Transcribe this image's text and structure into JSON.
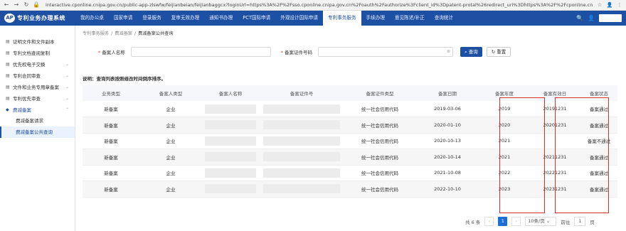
{
  "browser": {
    "url": "interactive.cponline.cnipa.gov.cn/public-app-zlswfw/feijianbeian/feijianbaggcx?loginUrl=https%3A%2F%2Fsso.cponline.cnipa.gov.cn%2Foauth%2Fauthorize%3Fclient_id%3Dpatent-protal%26redirect_uri%3Dhttps%3A%2F%2Fcponline.cnipa.gov.cn..."
  },
  "header": {
    "logo_mark": "AP",
    "title": "专利业务办理系统",
    "nav": [
      "我的办公桌",
      "国家申请",
      "登录服务",
      "复审无效办理",
      "通知书办理",
      "PCT国际申请",
      "外观设计国际申请",
      "专利事务服务",
      "手续办理",
      "意见陈述/补正",
      "查询统计"
    ],
    "active_nav": "专利事务服务"
  },
  "sidebar": {
    "items": [
      {
        "label": "证明文件和文件副本",
        "chevron": false
      },
      {
        "label": "专利文档查阅复制",
        "chevron": false
      },
      {
        "label": "优先权电子交换",
        "chevron": true
      },
      {
        "label": "专利合同审查",
        "chevron": true
      },
      {
        "label": "文件和业务专用章备案",
        "chevron": true
      },
      {
        "label": "专利优先审查",
        "chevron": true
      },
      {
        "label": "费减备案",
        "chevron": true,
        "open": true
      }
    ],
    "sub_items": [
      "费减备案请求",
      "费减备案公共查询"
    ]
  },
  "breadcrumb": {
    "items": [
      "专利事务服务",
      "费减备案",
      "费减备案公共查询"
    ]
  },
  "search": {
    "name_label": "备案人名称",
    "id_label": "备案证件号码",
    "query_button": "查询",
    "reset_button": "重置"
  },
  "note": "说明：查询列表按照修改时间倒序排序。",
  "table": {
    "columns": [
      "业务类型",
      "备案人类型",
      "备案人名称",
      "备案证件号",
      "备案证件类型",
      "备案日期",
      "备案年度",
      "备案有效日",
      "备案状态"
    ],
    "rows": [
      [
        "新备案",
        "企业",
        "",
        "",
        "统一社会信用代码",
        "2019-03-06",
        "2019",
        "20191231",
        "备案通过"
      ],
      [
        "新备案",
        "企业",
        "",
        "",
        "统一社会信用代码",
        "2020-01-10",
        "2020",
        "20201231",
        "备案通过"
      ],
      [
        "新备案",
        "企业",
        "",
        "",
        "统一社会信用代码",
        "2020-10-13",
        "2021",
        "",
        "备案不通过"
      ],
      [
        "新备案",
        "企业",
        "",
        "",
        "统一社会信用代码",
        "2020-10-14",
        "2021",
        "20211231",
        "备案通过"
      ],
      [
        "新备案",
        "企业",
        "",
        "",
        "统一社会信用代码",
        "2021-10-08",
        "2022",
        "20221231",
        "备案通过"
      ],
      [
        "新备案",
        "企业",
        "",
        "",
        "统一社会信用代码",
        "2022-10-10",
        "2023",
        "20231231",
        "备案通过"
      ]
    ]
  },
  "pagination": {
    "total": "共 6 条",
    "current_page": "1",
    "page_size": "10条/页",
    "goto_label": "前往",
    "goto_value": "1",
    "page_unit": "页"
  },
  "colors": {
    "brand": "#1d4fa3",
    "highlight": "#d9302c"
  }
}
